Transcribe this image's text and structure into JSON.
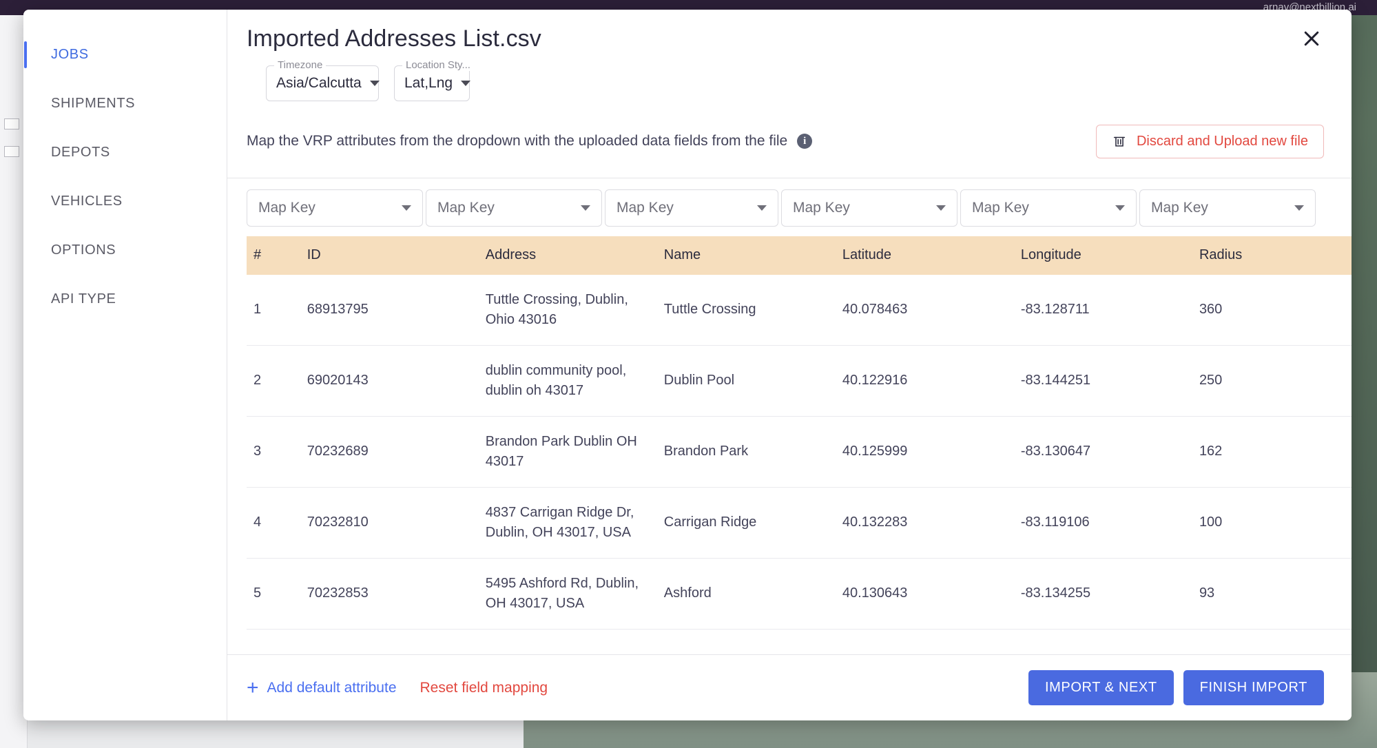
{
  "background": {
    "topbar_email": "arnav@nextbillion.ai"
  },
  "sidebar": {
    "items": [
      {
        "label": "JOBS",
        "active": true
      },
      {
        "label": "SHIPMENTS",
        "active": false
      },
      {
        "label": "DEPOTS",
        "active": false
      },
      {
        "label": "VEHICLES",
        "active": false
      },
      {
        "label": "OPTIONS",
        "active": false
      },
      {
        "label": "API TYPE",
        "active": false
      }
    ]
  },
  "header": {
    "title": "Imported Addresses List.csv",
    "close_icon": "close-icon",
    "timezone": {
      "label": "Timezone",
      "value": "Asia/Calcutta"
    },
    "location_style": {
      "label": "Location Sty...",
      "value": "Lat,Lng"
    }
  },
  "instruction": {
    "text": "Map the VRP attributes from the dropdown with the uploaded data fields from the file",
    "info_icon": "i",
    "discard_button": "Discard and Upload new file",
    "discard_icon": "trash-icon",
    "discard_color": "#e2483f"
  },
  "mapping": {
    "dropdown_placeholder": "Map Key",
    "dropdown_count": 6
  },
  "table": {
    "columns": [
      "#",
      "ID",
      "Address",
      "Name",
      "Latitude",
      "Longitude",
      "Radius"
    ],
    "header_bg": "#f6debd",
    "rows": [
      {
        "num": "1",
        "id": "68913795",
        "address": "Tuttle Crossing, Dublin, Ohio 43016",
        "name": "Tuttle Crossing",
        "latitude": "40.078463",
        "longitude": "-83.128711",
        "radius": "360"
      },
      {
        "num": "2",
        "id": "69020143",
        "address": "dublin community pool, dublin oh 43017",
        "name": "Dublin Pool",
        "latitude": "40.122916",
        "longitude": "-83.144251",
        "radius": "250"
      },
      {
        "num": "3",
        "id": "70232689",
        "address": "Brandon Park Dublin OH 43017",
        "name": "Brandon Park",
        "latitude": "40.125999",
        "longitude": "-83.130647",
        "radius": "162"
      },
      {
        "num": "4",
        "id": "70232810",
        "address": "4837 Carrigan Ridge Dr, Dublin, OH 43017, USA",
        "name": "Carrigan Ridge",
        "latitude": "40.132283",
        "longitude": "-83.119106",
        "radius": "100"
      },
      {
        "num": "5",
        "id": "70232853",
        "address": "5495 Ashford Rd, Dublin, OH 43017, USA",
        "name": "Ashford",
        "latitude": "40.130643",
        "longitude": "-83.134255",
        "radius": "93"
      }
    ]
  },
  "footer": {
    "add_attribute": "Add default attribute",
    "add_icon": "plus-icon",
    "reset_mapping": "Reset field mapping",
    "import_next": "IMPORT & NEXT",
    "finish_import": "FINISH IMPORT",
    "primary_color": "#4a6ae0"
  }
}
